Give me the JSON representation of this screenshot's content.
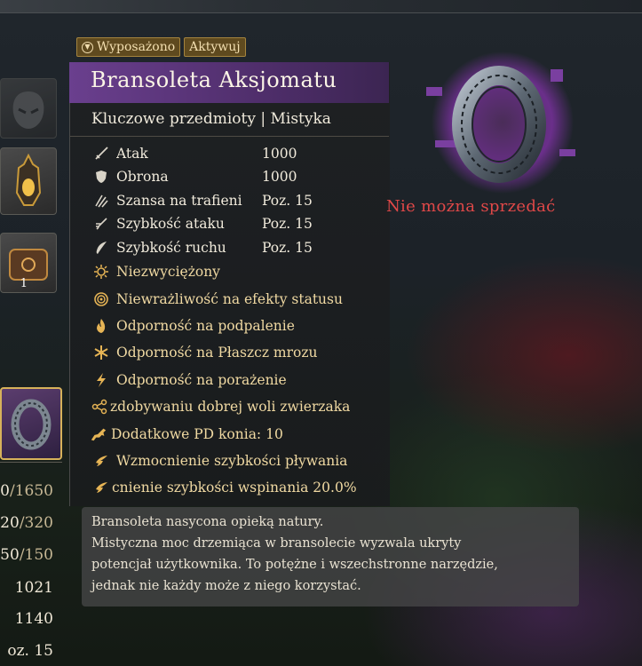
{
  "badges": {
    "equipped": "Wyposażono",
    "activate": "Aktywuj"
  },
  "item": {
    "title": "Bransoleta Aksjomatu",
    "subtitle": "Kluczowe przedmioty | Mistyka",
    "sell_notice": "Nie można sprzedać"
  },
  "stats": [
    {
      "icon": "sword-icon",
      "name": "Atak",
      "value": "1000"
    },
    {
      "icon": "shield-icon",
      "name": "Obrona",
      "value": "1000"
    },
    {
      "icon": "claw-icon",
      "name": "Szansa na trafieni",
      "value": "Poz. 15"
    },
    {
      "icon": "blade-speed-icon",
      "name": "Szybkość ataku",
      "value": "Poz. 15"
    },
    {
      "icon": "wing-icon",
      "name": "Szybkość ruchu",
      "value": "Poz. 15"
    }
  ],
  "effects": [
    {
      "icon": "sun-icon",
      "text": "Niezwyciężony"
    },
    {
      "icon": "swirl-icon",
      "text": "Niewrażliwość na efekty statusu"
    },
    {
      "icon": "flame-icon",
      "text": "Odporność na podpalenie"
    },
    {
      "icon": "snowflake-icon",
      "text": "Odporność na Płaszcz mrozu"
    },
    {
      "icon": "lightning-icon",
      "text": "Odporność na porażenie"
    },
    {
      "icon": "share-icon",
      "text": "zdobywaniu dobrej woli zwierzaka"
    },
    {
      "icon": "horse-icon",
      "text": "Dodatkowe PD konia: 10"
    },
    {
      "icon": "wing-icon",
      "text": "Wzmocnienie szybkości pływania"
    },
    {
      "icon": "wing-icon",
      "text": "cnienie szybkości wspinania 20.0%"
    }
  ],
  "description": [
    "Bransoleta nasycona opieką natury.",
    "Mistyczna moc drzemiąca w bransolecie wyzwala ukryty",
    "potencjał użytkownika. To potężne i wszechstronne narzędzie,",
    "jednak nie każdy może z niego korzystać."
  ],
  "inventory": {
    "slot3_qty": "1"
  },
  "left_stats": [
    {
      "cur": "0",
      "max": "/1650"
    },
    {
      "cur": "20",
      "max": "/320"
    },
    {
      "cur": "50",
      "max": "/150"
    },
    {
      "cur": "1021",
      "max": ""
    },
    {
      "cur": "1140",
      "max": ""
    },
    {
      "cur": "oz. 15",
      "max": ""
    }
  ],
  "colors": {
    "title_bar": "#6a3f8e",
    "gold_text": "#f0d9a2",
    "warning_red": "#e04848",
    "badge_bg": "#5f4a1f"
  }
}
